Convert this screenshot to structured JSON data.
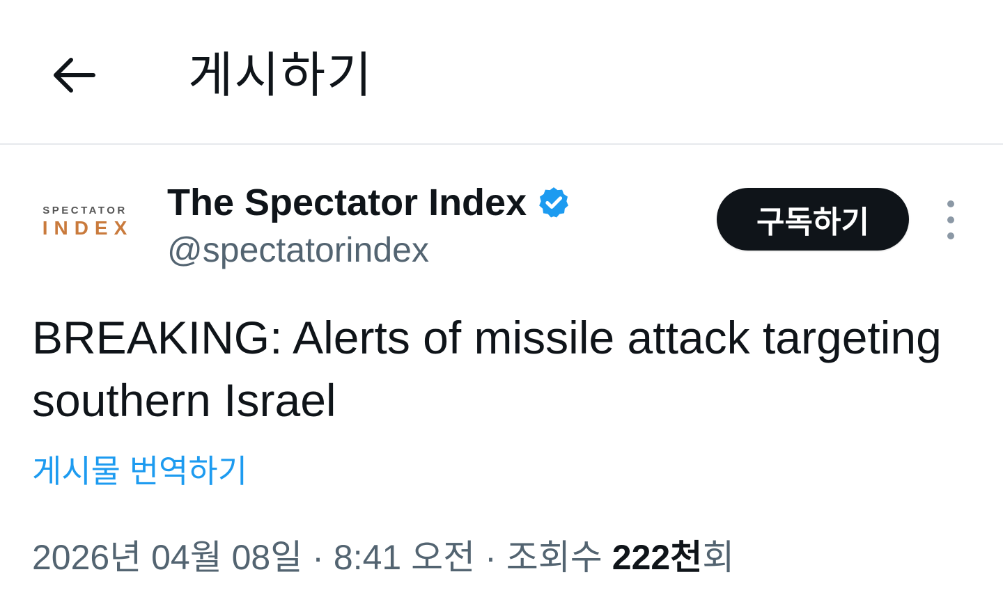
{
  "header": {
    "back_icon": "arrow-left-icon",
    "title": "게시하기"
  },
  "author": {
    "avatar_text_top": "SPECTATOR",
    "avatar_text_bottom": "INDEX",
    "display_name": "The Spectator Index",
    "verified_icon": "verified-badge-icon",
    "handle": "@spectatorindex",
    "subscribe_label": "구독하기",
    "more_icon": "more-vertical-icon"
  },
  "post": {
    "text": "BREAKING: Alerts of missile attack targeting southern Israel",
    "translate_label": "게시물 번역하기"
  },
  "meta": {
    "date": "2026년 04월 08일",
    "separator": "·",
    "time": "8:41 오전",
    "views_label": "조회수",
    "views_count": "222천",
    "views_suffix": "회"
  },
  "colors": {
    "accent": "#1d9bf0",
    "text": "#0f1419",
    "secondary": "#536471",
    "button_bg": "#0f1419",
    "avatar_orange": "#c97a3c"
  }
}
